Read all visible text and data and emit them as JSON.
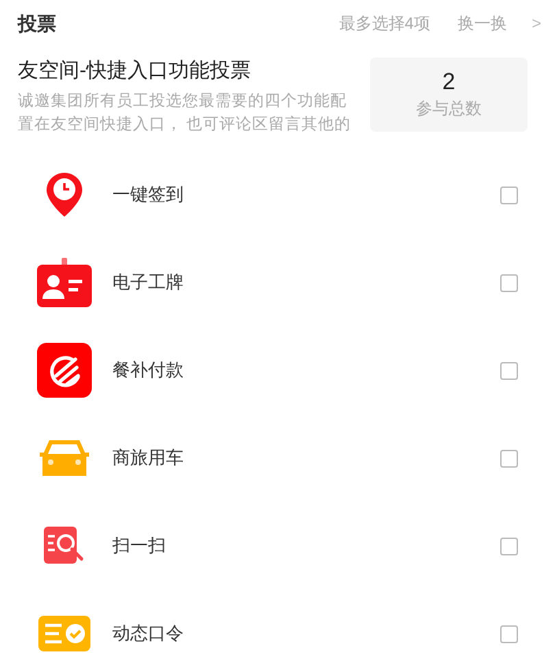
{
  "header": {
    "title": "投票",
    "limit": "最多选择4项",
    "refresh": "换一换",
    "chevron": ">"
  },
  "poll": {
    "title": "友空间-快捷入口功能投票",
    "description": "诚邀集团所有员工投选您最需要的四个功能配置在友空间快捷入口， 也可评论区留言其他的",
    "count": "2",
    "count_label": "参与总数"
  },
  "options": [
    {
      "kind": "pin",
      "label": "一键签到",
      "checked": false
    },
    {
      "kind": "badge",
      "label": "电子工牌",
      "checked": false
    },
    {
      "kind": "meal",
      "label": "餐补付款",
      "checked": false
    },
    {
      "kind": "car",
      "label": "商旅用车",
      "checked": false
    },
    {
      "kind": "scan",
      "label": "扫一扫",
      "checked": false
    },
    {
      "kind": "token",
      "label": "动态口令",
      "checked": false
    }
  ]
}
